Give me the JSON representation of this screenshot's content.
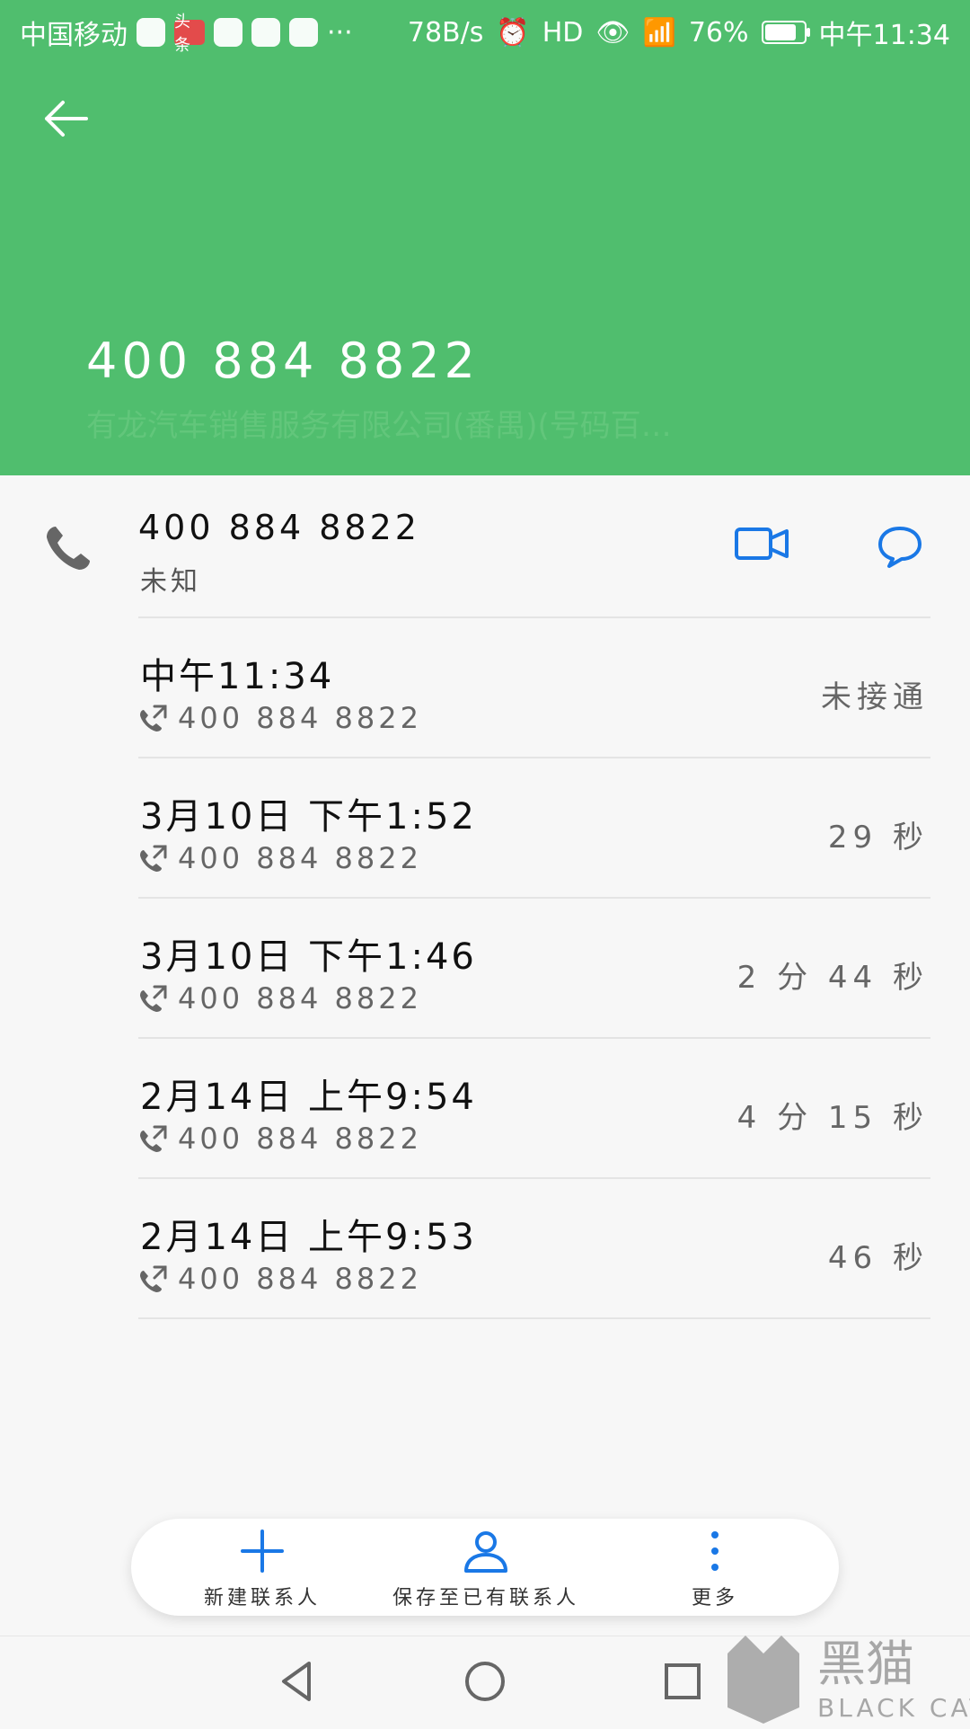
{
  "status_bar": {
    "carrier": "中国移动",
    "speed": "78B/s",
    "battery": "76%",
    "time": "中午11:34",
    "toutiao": "头条"
  },
  "header": {
    "title": "400 884 8822",
    "subtitle": "有龙汽车销售服务有限公司(番禺)(号码百…"
  },
  "contact": {
    "number": "400 884 8822",
    "type": "未知"
  },
  "logs": [
    {
      "time": "中午11:34",
      "number": "400 884 8822",
      "duration": "未接通"
    },
    {
      "time": "3月10日 下午1:52",
      "number": "400 884 8822",
      "duration": "29 秒"
    },
    {
      "time": "3月10日 下午1:46",
      "number": "400 884 8822",
      "duration": "2 分 44 秒"
    },
    {
      "time": "2月14日 上午9:54",
      "number": "400 884 8822",
      "duration": "4 分 15 秒"
    },
    {
      "time": "2月14日 上午9:53",
      "number": "400 884 8822",
      "duration": "46 秒"
    }
  ],
  "actions": {
    "new_contact": "新建联系人",
    "save_existing": "保存至已有联系人",
    "more": "更多"
  },
  "colors": {
    "header": "#50be6e",
    "accent_blue": "#1a78e6"
  },
  "watermark": {
    "main": "黑猫",
    "sub": "BLACK CAT"
  }
}
